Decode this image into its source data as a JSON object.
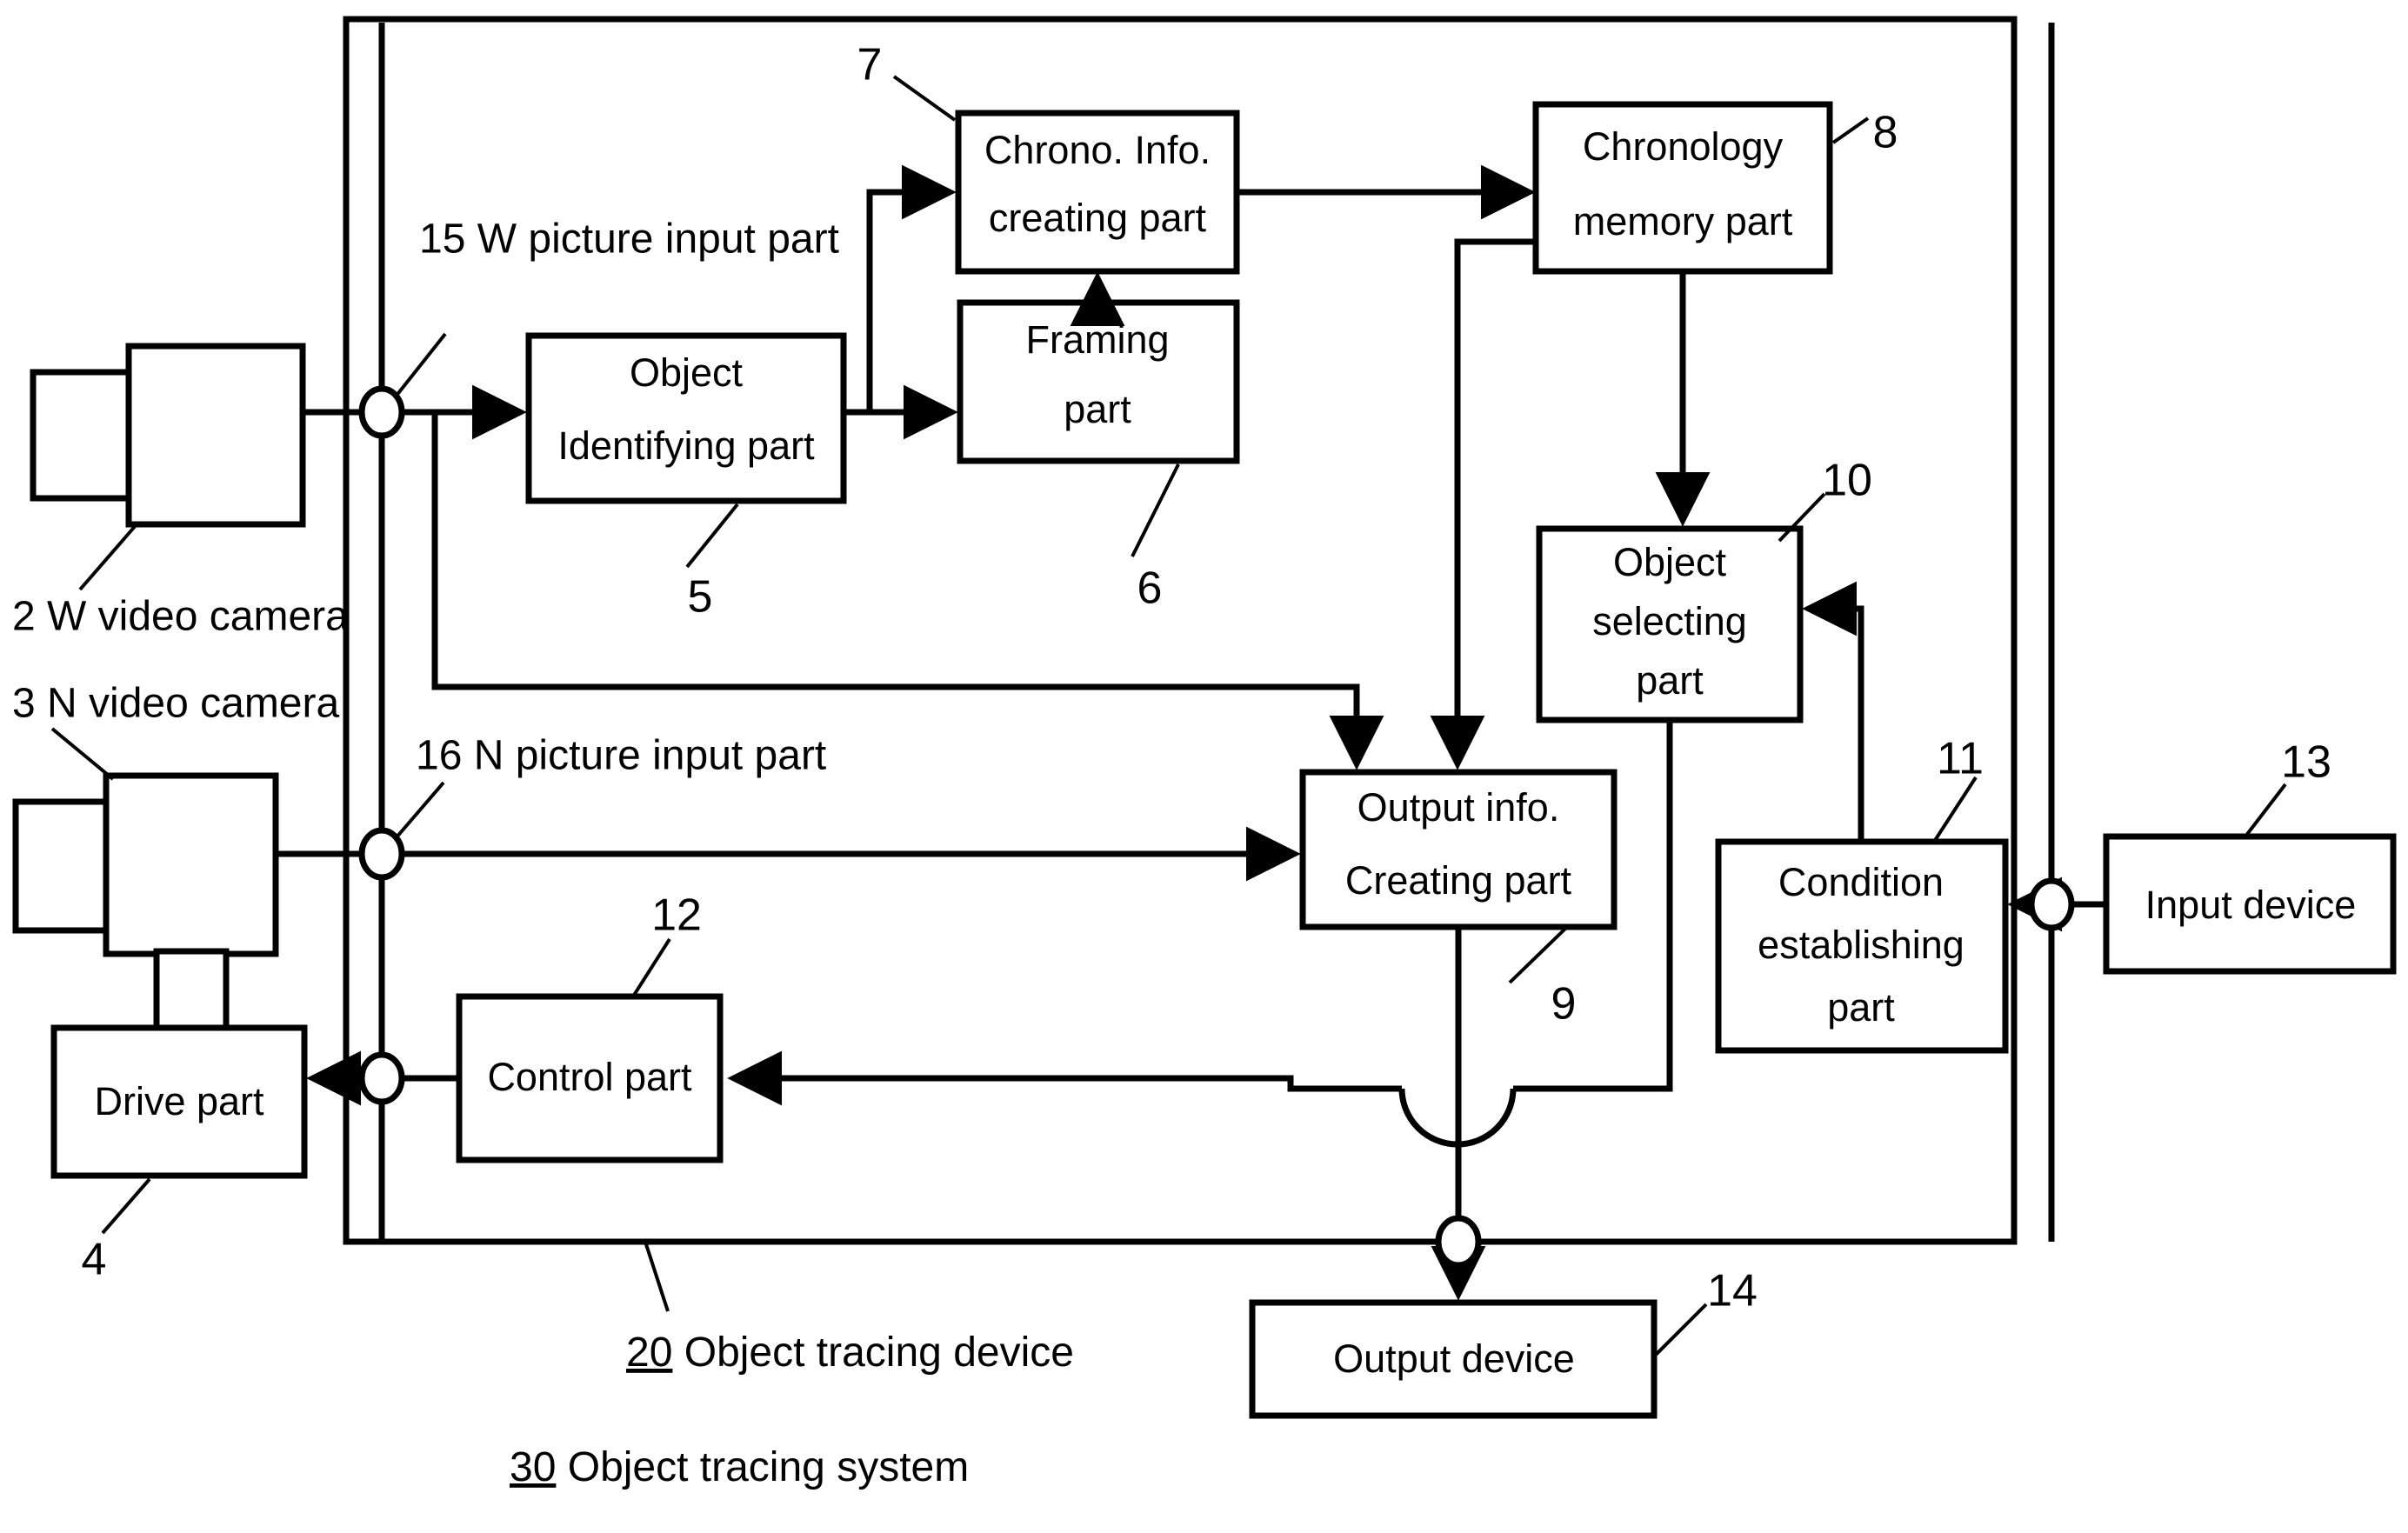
{
  "figure": {
    "title": "Object tracing system block diagram",
    "line_color": "#000000",
    "fill_color": "#ffffff"
  },
  "blocks": {
    "w_video_camera": {
      "label": "",
      "ref": "2",
      "caption": "2 W video camera"
    },
    "n_video_camera": {
      "label": "",
      "ref": "3",
      "caption": "3 N video camera"
    },
    "drive_part": {
      "label": "Drive part",
      "ref": "4"
    },
    "object_identifying_part": {
      "line1": "Object",
      "line2": "Identifying part",
      "ref": "5"
    },
    "framing_part": {
      "line1": "Framing",
      "line2": "part",
      "ref": "6"
    },
    "chrono_info_creating_part": {
      "line1": "Chrono. Info.",
      "line2": "creating part",
      "ref": "7"
    },
    "chronology_memory_part": {
      "line1": "Chronology",
      "line2": "memory part",
      "ref": "8"
    },
    "output_info_creating_part": {
      "line1": "Output info.",
      "line2": "Creating part",
      "ref": "9"
    },
    "object_selecting_part": {
      "line1": "Object",
      "line2": "selecting",
      "line3": "part",
      "ref": "10"
    },
    "condition_establishing_part": {
      "line1": "Condition",
      "line2": "establishing",
      "line3": "part",
      "ref": "11"
    },
    "control_part": {
      "label": "Control part",
      "ref": "12"
    },
    "input_device": {
      "label": "Input device",
      "ref": "13"
    },
    "output_device": {
      "label": "Output device",
      "ref": "14"
    }
  },
  "nodes": {
    "w_picture_input_part": {
      "ref": "15",
      "caption": "15 W picture input part"
    },
    "n_picture_input_part": {
      "ref": "16",
      "caption": "16 N picture input part"
    }
  },
  "captions": {
    "object_tracing_device_num": "20",
    "object_tracing_device_text": " Object tracing device",
    "object_tracing_system_num": "30",
    "object_tracing_system_text": " Object tracing system"
  }
}
